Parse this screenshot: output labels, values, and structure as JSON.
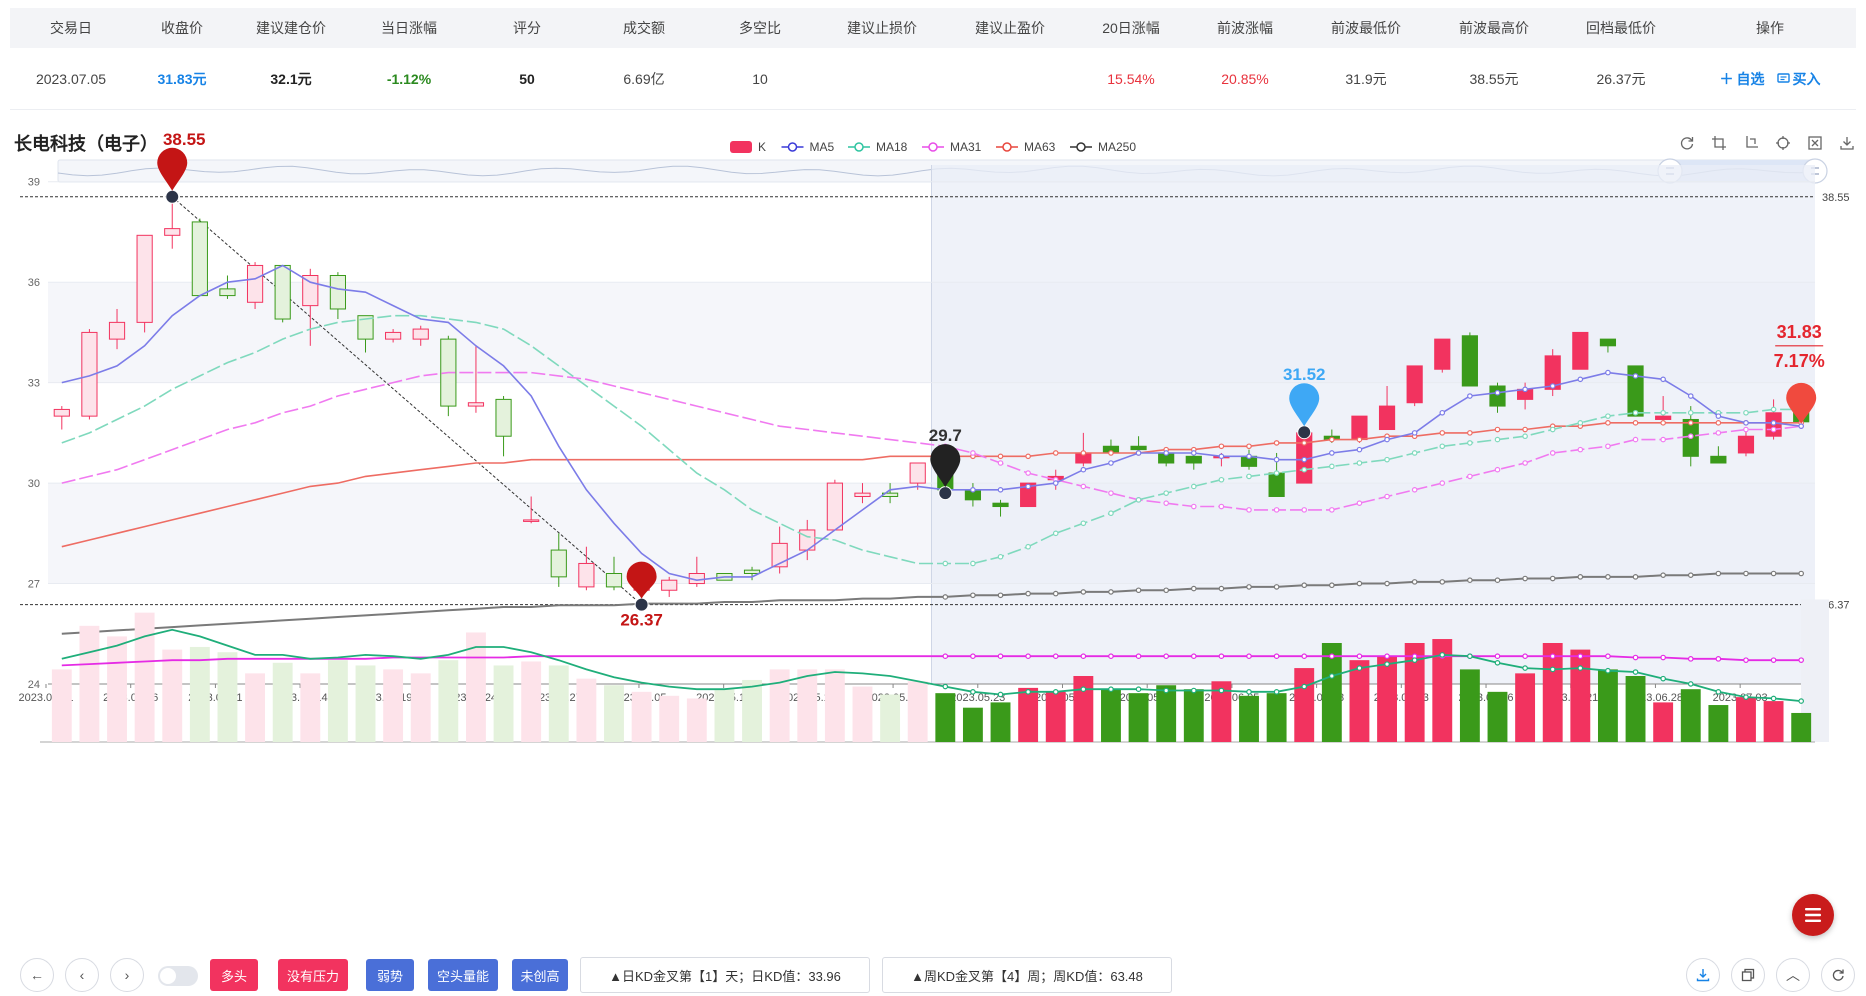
{
  "summary": {
    "headers": [
      "交易日",
      "收盘价",
      "建议建仓价",
      "当日涨幅",
      "评分",
      "成交额",
      "多空比",
      "建议止损价",
      "建议止盈价",
      "20日涨幅",
      "前波涨幅",
      "前波最低价",
      "前波最高价",
      "回档最低价",
      "操作"
    ],
    "row": {
      "trade_date": "2023.07.05",
      "close_price": "31.83元",
      "entry_price": "32.1元",
      "day_change": "-1.12%",
      "score": "50",
      "turnover": "6.69亿",
      "long_short_ratio": "10",
      "stop_loss": "",
      "take_profit": "",
      "change_20d": "15.54%",
      "prev_wave_change": "20.85%",
      "prev_wave_low": "31.9元",
      "prev_wave_high": "38.55元",
      "pullback_low": "26.37元"
    },
    "actions": {
      "watch": "自选",
      "buy": "买入"
    }
  },
  "stock_title": "长电科技（电子）",
  "legend": [
    {
      "name": "K",
      "color": "#f2335f"
    },
    {
      "name": "MA5",
      "color": "#3a3ad8"
    },
    {
      "name": "MA18",
      "color": "#2ec4a0"
    },
    {
      "name": "MA31",
      "color": "#e84de8"
    },
    {
      "name": "MA63",
      "color": "#e8473d"
    },
    {
      "name": "MA250",
      "color": "#333333"
    }
  ],
  "colors": {
    "up": "#f2335f",
    "down": "#3a9a1a",
    "highlight_bg": "#e9edf7"
  },
  "chart_data": {
    "type": "candlestick",
    "ylim": [
      24,
      39.5
    ],
    "y_ticks": [
      24,
      27,
      30,
      33,
      36,
      39
    ],
    "x_tick_labels": [
      "2023.03.31",
      "2023.04.06",
      "2023.04.11",
      "2023.04.14",
      "2023.04.19",
      "2023.04.24",
      "2023.04.27",
      "2023.05.05",
      "2023.05.10",
      "2023.05.15",
      "2023.05.18",
      "2023.05.23",
      "2023.05.26",
      "2023.05.31",
      "2023.06.05",
      "2023.06.08",
      "2023.06.13",
      "2023.06.16",
      "2023.06.21",
      "2023.06.28",
      "2023.07.03"
    ],
    "ohlc": [
      [
        32.0,
        32.3,
        31.6,
        32.2
      ],
      [
        32.0,
        34.6,
        31.9,
        34.5
      ],
      [
        34.3,
        35.2,
        34.0,
        34.8
      ],
      [
        34.8,
        37.4,
        34.5,
        37.4
      ],
      [
        37.4,
        38.55,
        37.0,
        37.6
      ],
      [
        37.8,
        37.9,
        35.7,
        35.6
      ],
      [
        35.8,
        36.2,
        35.5,
        35.6
      ],
      [
        35.4,
        36.6,
        35.2,
        36.5
      ],
      [
        36.5,
        36.5,
        34.8,
        34.9
      ],
      [
        35.3,
        36.4,
        34.1,
        36.2
      ],
      [
        36.2,
        36.3,
        34.9,
        35.2
      ],
      [
        35.0,
        35.0,
        33.9,
        34.3
      ],
      [
        34.3,
        34.6,
        34.2,
        34.5
      ],
      [
        34.3,
        34.7,
        34.1,
        34.6
      ],
      [
        34.3,
        34.4,
        32.0,
        32.3
      ],
      [
        32.3,
        34.1,
        32.1,
        32.4
      ],
      [
        32.5,
        32.6,
        30.8,
        31.4
      ],
      [
        28.9,
        29.6,
        28.8,
        28.9
      ],
      [
        28.0,
        28.5,
        26.9,
        27.2
      ],
      [
        26.9,
        28.1,
        26.8,
        27.6
      ],
      [
        27.3,
        27.8,
        26.8,
        26.9
      ],
      [
        26.8,
        27.6,
        26.37,
        27.2
      ],
      [
        26.8,
        27.2,
        26.6,
        27.1
      ],
      [
        27.0,
        27.8,
        26.9,
        27.3
      ],
      [
        27.3,
        27.3,
        27.1,
        27.1
      ],
      [
        27.4,
        27.5,
        27.1,
        27.3
      ],
      [
        27.5,
        28.7,
        27.3,
        28.2
      ],
      [
        28.0,
        28.9,
        27.7,
        28.6
      ],
      [
        28.6,
        30.1,
        28.6,
        30.0
      ],
      [
        29.6,
        30.0,
        29.4,
        29.7
      ],
      [
        29.7,
        30.0,
        29.4,
        29.6
      ],
      [
        30.0,
        30.6,
        29.8,
        30.6
      ],
      [
        30.5,
        30.9,
        29.8,
        29.8
      ],
      [
        29.8,
        30.0,
        29.3,
        29.5
      ],
      [
        29.4,
        29.5,
        29.0,
        29.3
      ],
      [
        29.3,
        30.0,
        29.3,
        30.0
      ],
      [
        30.1,
        30.4,
        29.8,
        30.2
      ],
      [
        30.6,
        31.5,
        30.5,
        30.9
      ],
      [
        31.1,
        31.3,
        31.0,
        30.9
      ],
      [
        31.1,
        31.4,
        31.0,
        31.0
      ],
      [
        30.9,
        30.9,
        30.5,
        30.6
      ],
      [
        30.8,
        30.9,
        30.4,
        30.6
      ],
      [
        30.8,
        30.9,
        30.5,
        30.8
      ],
      [
        30.8,
        31.0,
        30.4,
        30.5
      ],
      [
        30.3,
        30.9,
        29.6,
        29.6
      ],
      [
        30.0,
        31.52,
        30.0,
        31.5
      ],
      [
        31.4,
        31.6,
        31.2,
        31.3
      ],
      [
        31.3,
        32.0,
        31.2,
        32.0
      ],
      [
        31.6,
        32.9,
        31.6,
        32.3
      ],
      [
        32.4,
        33.5,
        32.3,
        33.5
      ],
      [
        33.4,
        34.3,
        33.3,
        34.3
      ],
      [
        34.4,
        34.5,
        32.9,
        32.9
      ],
      [
        32.9,
        33.0,
        32.1,
        32.3
      ],
      [
        32.5,
        33.0,
        32.2,
        32.8
      ],
      [
        32.8,
        34.0,
        32.6,
        33.8
      ],
      [
        33.4,
        34.5,
        33.4,
        34.5
      ],
      [
        34.3,
        34.3,
        33.9,
        34.1
      ],
      [
        33.5,
        33.5,
        32.0,
        32.0
      ],
      [
        31.9,
        32.6,
        31.9,
        32.0
      ],
      [
        31.9,
        32.3,
        30.5,
        30.8
      ],
      [
        30.8,
        31.1,
        30.6,
        30.6
      ],
      [
        30.9,
        31.6,
        30.8,
        31.4
      ],
      [
        31.4,
        32.5,
        31.3,
        32.1
      ],
      [
        32.2,
        32.4,
        31.7,
        31.83
      ]
    ],
    "ma5": [
      33.0,
      33.2,
      33.5,
      34.1,
      35.0,
      35.6,
      36.0,
      36.1,
      36.5,
      36.0,
      35.8,
      35.7,
      35.3,
      34.9,
      34.8,
      34.1,
      33.5,
      32.6,
      31.1,
      29.8,
      28.8,
      27.9,
      27.3,
      27.1,
      27.2,
      27.2,
      27.6,
      28.0,
      28.6,
      29.2,
      29.8,
      29.9,
      29.8,
      29.8,
      29.8,
      29.9,
      30.0,
      30.4,
      30.6,
      30.9,
      30.9,
      30.9,
      30.8,
      30.8,
      30.7,
      30.7,
      30.9,
      31.0,
      31.3,
      31.5,
      32.1,
      32.6,
      32.7,
      32.8,
      32.9,
      33.1,
      33.3,
      33.2,
      33.1,
      32.6,
      32.0,
      31.8,
      31.8,
      31.7
    ],
    "ma18": [
      31.2,
      31.5,
      31.9,
      32.3,
      32.8,
      33.2,
      33.6,
      33.9,
      34.3,
      34.6,
      34.8,
      34.9,
      35.0,
      35.0,
      34.9,
      34.8,
      34.6,
      34.1,
      33.5,
      32.9,
      32.3,
      31.7,
      31.0,
      30.3,
      29.8,
      29.2,
      28.8,
      28.4,
      28.3,
      28.0,
      27.8,
      27.6,
      27.6,
      27.6,
      27.8,
      28.1,
      28.5,
      28.8,
      29.1,
      29.5,
      29.7,
      29.9,
      30.1,
      30.2,
      30.3,
      30.4,
      30.5,
      30.6,
      30.7,
      30.9,
      31.1,
      31.2,
      31.3,
      31.4,
      31.6,
      31.8,
      32.0,
      32.1,
      32.1,
      32.1,
      32.1,
      32.1,
      32.2,
      32.2
    ],
    "ma31": [
      30.0,
      30.2,
      30.4,
      30.7,
      31.0,
      31.3,
      31.6,
      31.8,
      32.1,
      32.3,
      32.6,
      32.8,
      33.0,
      33.2,
      33.3,
      33.3,
      33.3,
      33.3,
      33.2,
      33.1,
      32.9,
      32.7,
      32.5,
      32.3,
      32.1,
      31.9,
      31.7,
      31.6,
      31.5,
      31.4,
      31.3,
      31.2,
      31.1,
      30.9,
      30.6,
      30.3,
      30.1,
      29.9,
      29.7,
      29.5,
      29.4,
      29.3,
      29.3,
      29.2,
      29.2,
      29.2,
      29.2,
      29.4,
      29.6,
      29.8,
      30.0,
      30.2,
      30.4,
      30.6,
      30.9,
      31.0,
      31.1,
      31.3,
      31.3,
      31.4,
      31.5,
      31.6,
      31.6,
      31.7
    ],
    "ma63": [
      28.1,
      28.3,
      28.5,
      28.7,
      28.9,
      29.1,
      29.3,
      29.5,
      29.7,
      29.9,
      30.0,
      30.2,
      30.3,
      30.4,
      30.5,
      30.6,
      30.6,
      30.7,
      30.7,
      30.7,
      30.7,
      30.7,
      30.7,
      30.7,
      30.7,
      30.7,
      30.7,
      30.7,
      30.7,
      30.7,
      30.8,
      30.8,
      30.8,
      30.8,
      30.8,
      30.8,
      30.9,
      30.9,
      30.9,
      30.9,
      31.0,
      31.0,
      31.1,
      31.1,
      31.2,
      31.2,
      31.3,
      31.3,
      31.4,
      31.4,
      31.5,
      31.5,
      31.6,
      31.6,
      31.7,
      31.7,
      31.8,
      31.8,
      31.8,
      31.8,
      31.8,
      31.8,
      31.8,
      31.8
    ],
    "ma250": [
      25.5,
      25.55,
      25.6,
      25.65,
      25.7,
      25.75,
      25.8,
      25.85,
      25.9,
      25.95,
      26.0,
      26.05,
      26.1,
      26.15,
      26.2,
      26.25,
      26.3,
      26.3,
      26.35,
      26.35,
      26.35,
      26.4,
      26.4,
      26.4,
      26.45,
      26.45,
      26.5,
      26.5,
      26.5,
      26.55,
      26.55,
      26.6,
      26.6,
      26.65,
      26.65,
      26.7,
      26.7,
      26.75,
      26.75,
      26.8,
      26.8,
      26.85,
      26.85,
      26.9,
      26.9,
      26.95,
      26.95,
      27.0,
      27.0,
      27.05,
      27.05,
      27.1,
      27.1,
      27.15,
      27.15,
      27.2,
      27.2,
      27.2,
      27.25,
      27.25,
      27.3,
      27.3,
      27.3,
      27.3
    ],
    "highlight_start_index": 32,
    "ref_lines": [
      38.55,
      26.37
    ],
    "markers": [
      {
        "label": "38.55",
        "index": 4,
        "value": 38.55,
        "color": "#c41515"
      },
      {
        "label": "26.37",
        "index": 21,
        "value": 26.37,
        "color": "#c41515"
      },
      {
        "label": "29.7",
        "index": 32,
        "value": 29.7,
        "color": "#222222"
      },
      {
        "label": "31.52",
        "index": 45,
        "value": 31.52,
        "color": "#3ea8f5"
      }
    ],
    "last_price": "31.83",
    "last_change": "7.17%",
    "volume": [
      0.55,
      0.88,
      0.8,
      0.98,
      0.7,
      0.72,
      0.68,
      0.52,
      0.6,
      0.52,
      0.62,
      0.58,
      0.55,
      0.52,
      0.62,
      0.83,
      0.58,
      0.61,
      0.58,
      0.48,
      0.43,
      0.38,
      0.35,
      0.33,
      0.4,
      0.47,
      0.55,
      0.55,
      0.55,
      0.42,
      0.36,
      0.46,
      0.37,
      0.26,
      0.3,
      0.41,
      0.38,
      0.5,
      0.4,
      0.37,
      0.43,
      0.4,
      0.46,
      0.35,
      0.37,
      0.56,
      0.75,
      0.62,
      0.65,
      0.75,
      0.78,
      0.55,
      0.38,
      0.52,
      0.75,
      0.7,
      0.55,
      0.5,
      0.3,
      0.4,
      0.28,
      0.34,
      0.31,
      0.22
    ],
    "vol_ma_fast": [
      0.63,
      0.68,
      0.73,
      0.8,
      0.85,
      0.8,
      0.73,
      0.66,
      0.66,
      0.63,
      0.64,
      0.66,
      0.65,
      0.63,
      0.66,
      0.72,
      0.72,
      0.68,
      0.62,
      0.55,
      0.49,
      0.45,
      0.42,
      0.4,
      0.4,
      0.42,
      0.45,
      0.5,
      0.53,
      0.52,
      0.5,
      0.46,
      0.42,
      0.38,
      0.36,
      0.38,
      0.38,
      0.4,
      0.4,
      0.4,
      0.39,
      0.39,
      0.39,
      0.38,
      0.38,
      0.42,
      0.5,
      0.56,
      0.59,
      0.62,
      0.66,
      0.65,
      0.6,
      0.56,
      0.55,
      0.56,
      0.54,
      0.53,
      0.48,
      0.44,
      0.38,
      0.34,
      0.33,
      0.31
    ],
    "vol_ma_slow": [
      0.58,
      0.59,
      0.6,
      0.61,
      0.62,
      0.62,
      0.63,
      0.63,
      0.63,
      0.63,
      0.63,
      0.63,
      0.64,
      0.64,
      0.64,
      0.64,
      0.64,
      0.65,
      0.65,
      0.65,
      0.65,
      0.65,
      0.65,
      0.65,
      0.65,
      0.65,
      0.65,
      0.65,
      0.65,
      0.65,
      0.65,
      0.65,
      0.65,
      0.65,
      0.65,
      0.65,
      0.65,
      0.65,
      0.65,
      0.65,
      0.65,
      0.65,
      0.65,
      0.65,
      0.65,
      0.65,
      0.65,
      0.65,
      0.65,
      0.65,
      0.65,
      0.65,
      0.65,
      0.65,
      0.65,
      0.65,
      0.65,
      0.64,
      0.64,
      0.63,
      0.63,
      0.62,
      0.62,
      0.62
    ]
  },
  "bottom": {
    "tags": [
      {
        "label": "多头",
        "style": "red"
      },
      {
        "label": "没有压力",
        "style": "red"
      },
      {
        "label": "弱势",
        "style": "blue"
      },
      {
        "label": "空头量能",
        "style": "blue"
      },
      {
        "label": "未创高",
        "style": "blue"
      }
    ],
    "signals": [
      "▲日KD金叉第【1】天；日KD值：33.96",
      "▲周KD金叉第【4】周；周KD值：63.48"
    ]
  }
}
